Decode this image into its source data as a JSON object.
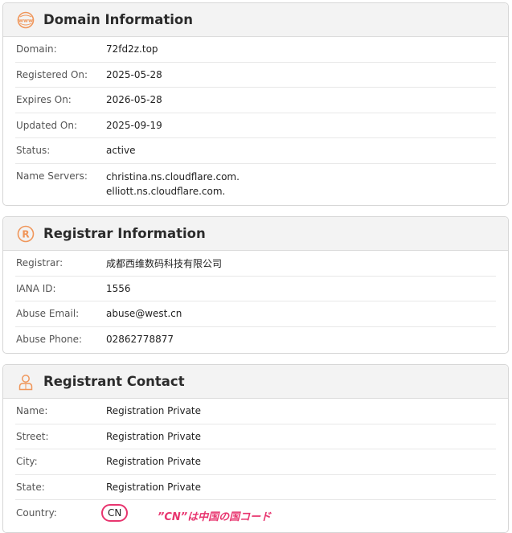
{
  "domain_card": {
    "title": "Domain Information",
    "rows": [
      {
        "label": "Domain:",
        "value": "72fd2z.top"
      },
      {
        "label": "Registered On:",
        "value": "2025-05-28"
      },
      {
        "label": "Expires On:",
        "value": "2026-05-28"
      },
      {
        "label": "Updated On:",
        "value": "2025-09-19"
      },
      {
        "label": "Status:",
        "value": "active"
      }
    ],
    "nameservers_label": "Name Servers:",
    "nameservers": [
      "christina.ns.cloudflare.com.",
      "elliott.ns.cloudflare.com."
    ],
    "icon": "www-globe-icon"
  },
  "registrar_card": {
    "title": "Registrar Information",
    "rows": [
      {
        "label": "Registrar:",
        "value": "成都西维数码科技有限公司"
      },
      {
        "label": "IANA ID:",
        "value": "1556"
      },
      {
        "label": "Abuse Email:",
        "value": "abuse@west.cn"
      },
      {
        "label": "Abuse Phone:",
        "value": "02862778877"
      }
    ],
    "icon": "registered-mark-icon"
  },
  "registrant_card": {
    "title": "Registrant Contact",
    "rows": [
      {
        "label": "Name:",
        "value": "Registration Private"
      },
      {
        "label": "Street:",
        "value": "Registration Private"
      },
      {
        "label": "City:",
        "value": "Registration Private"
      },
      {
        "label": "State:",
        "value": "Registration Private"
      }
    ],
    "country_label": "Country:",
    "country_value": "CN",
    "icon": "person-icon"
  },
  "annotation": "”CN”は中国の国コード",
  "colors": {
    "accent_orange": "#f0965a",
    "annotation_pink": "#e8356f"
  }
}
